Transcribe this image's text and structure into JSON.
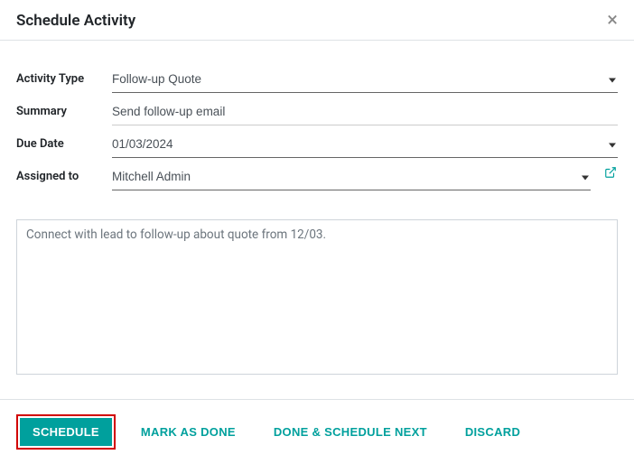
{
  "header": {
    "title": "Schedule Activity",
    "close_glyph": "×"
  },
  "fields": {
    "activity_type": {
      "label": "Activity Type",
      "value": "Follow-up Quote"
    },
    "summary": {
      "label": "Summary",
      "value": "Send follow-up email"
    },
    "due_date": {
      "label": "Due Date",
      "value": "01/03/2024"
    },
    "assigned_to": {
      "label": "Assigned to",
      "value": "Mitchell Admin"
    }
  },
  "notes": {
    "value": "Connect with lead to follow-up about quote from 12/03."
  },
  "buttons": {
    "schedule": "Schedule",
    "mark_done": "Mark As Done",
    "done_next": "Done & Schedule Next",
    "discard": "Discard"
  }
}
